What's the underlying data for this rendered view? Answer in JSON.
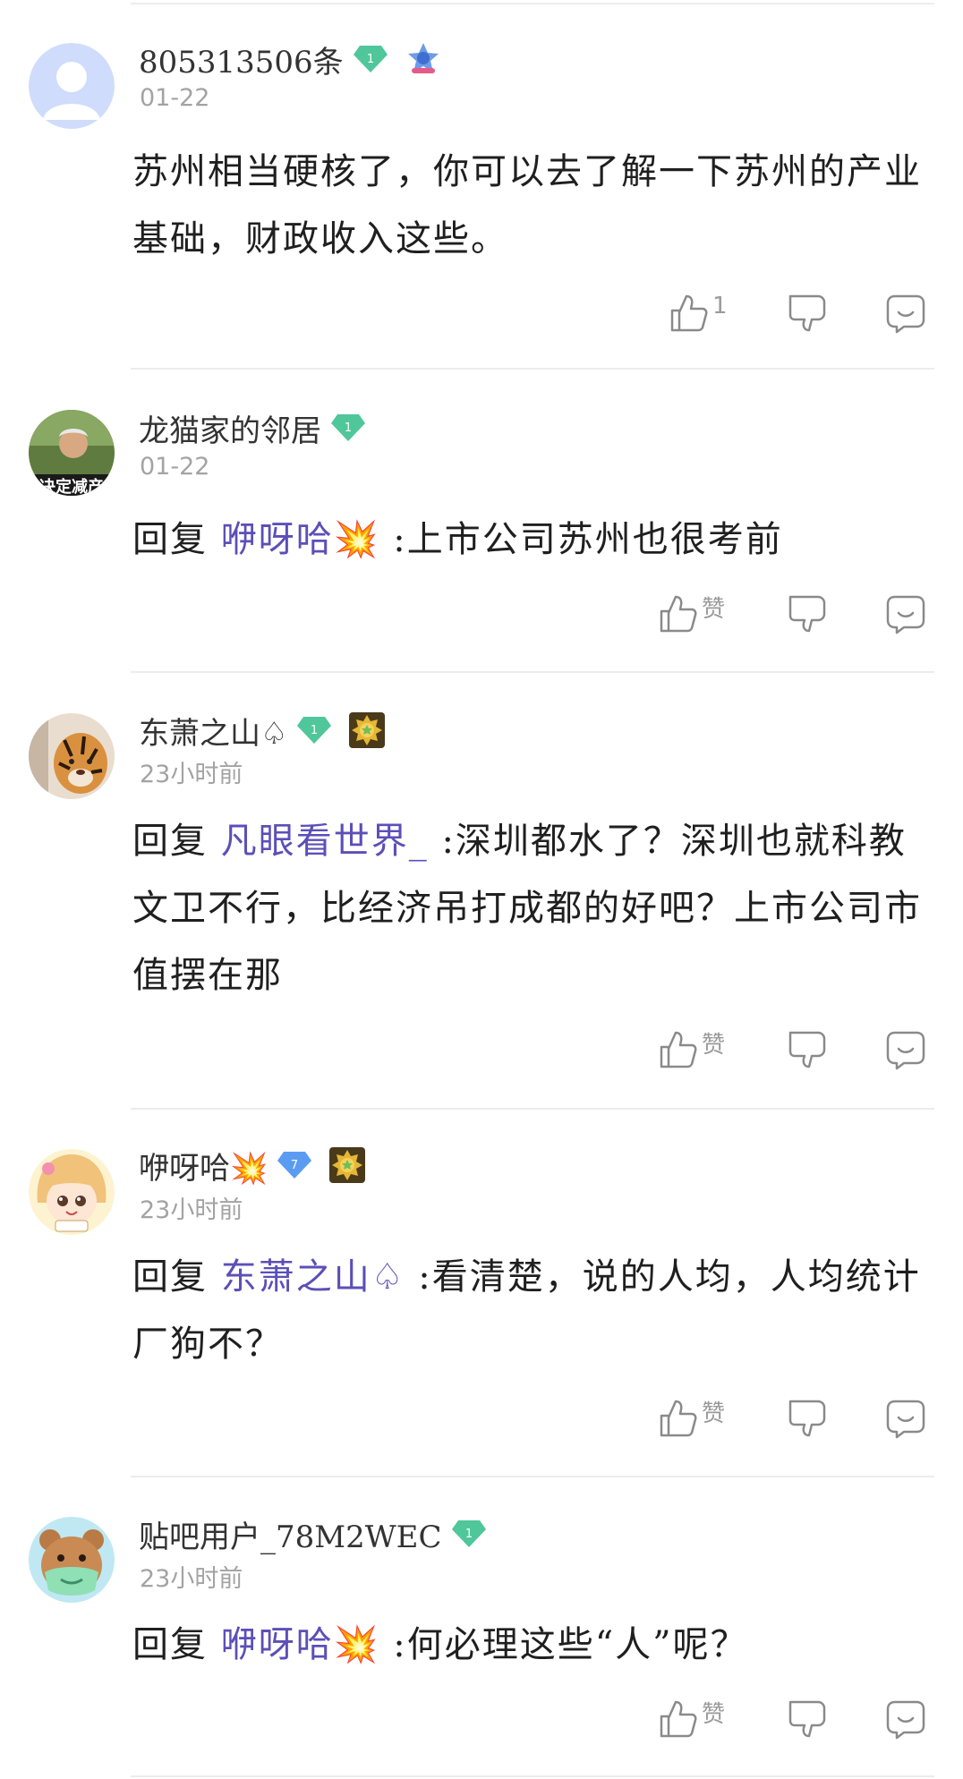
{
  "comments": [
    {
      "username": "805313506条",
      "level": "1",
      "level_color": "#4fc79a",
      "time": "01-22",
      "content": "苏州相当硬核了，你可以去了解一下苏州的产业基础，财政收入这些。",
      "reply_prefix": "",
      "reply_target": "",
      "like_label": "1",
      "avatar_icon": "default-avatar-icon",
      "medal_icon": "star-medal-icon"
    },
    {
      "username": "龙猫家的邻居",
      "level": "1",
      "level_color": "#4fc79a",
      "time": "01-22",
      "reply_prefix": "回复",
      "reply_target": "咿呀哈💥",
      "content": " :上市公司苏州也很考前",
      "like_label": "赞",
      "avatar_icon": "photo-avatar-icon"
    },
    {
      "username": "东萧之山♤",
      "level": "1",
      "level_color": "#4fc79a",
      "time": "23小时前",
      "reply_prefix": "回复",
      "reply_target": "凡眼看世界_",
      "content": " :深圳都水了？深圳也就科教文卫不行，比经济吊打成都的好吧？上市公司市值摆在那",
      "like_label": "赞",
      "avatar_icon": "tiger-avatar-icon",
      "medal_icon": "gold-medal-icon"
    },
    {
      "username": "咿呀哈💥",
      "level": "7",
      "level_color": "#5b9cf2",
      "time": "23小时前",
      "reply_prefix": "回复",
      "reply_target": "东萧之山♤",
      "content": " :看清楚，说的人均，人均统计厂狗不？",
      "like_label": "赞",
      "avatar_icon": "anime-avatar-icon",
      "medal_icon": "gold-medal-icon"
    },
    {
      "username": "贴吧用户_78M2WEC",
      "level": "1",
      "level_color": "#4fc79a",
      "time": "23小时前",
      "reply_prefix": "回复",
      "reply_target": "咿呀哈💥",
      "content": " :何必理这些“人”呢？",
      "like_label": "赞",
      "avatar_icon": "bear-avatar-icon"
    }
  ]
}
